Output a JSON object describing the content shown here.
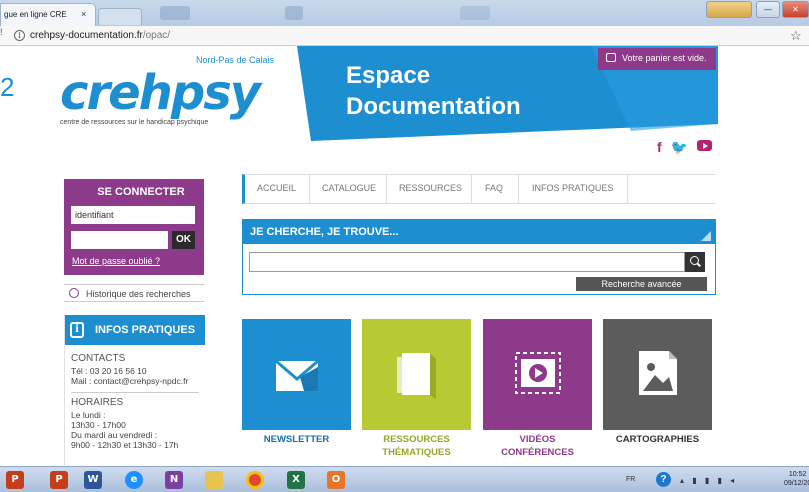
{
  "browser": {
    "tab_title": "gue en ligne CRE",
    "tab_close": "×",
    "address_domain": "crehpsy-documentation.fr",
    "address_path": "/opac/",
    "left_crumb": "!",
    "win_controls": [
      "",
      "—",
      "✕"
    ]
  },
  "site": {
    "stray_char": "2",
    "logo": {
      "region": "Nord-Pas de Calais",
      "word": "crehpsy",
      "tagline": "centre de ressources sur le handicap psychique"
    },
    "banner_line1": "Espace",
    "banner_line2": "Documentation",
    "cart_text": "Votre panier est vide.",
    "socials": [
      "f",
      "t",
      "youtube"
    ],
    "colors": {
      "blue": "#1d8fd1",
      "purple": "#8e3a8b",
      "green": "#b7c933",
      "magenta": "#b5236f",
      "gray": "#5c5c5c"
    }
  },
  "login": {
    "title": "SE CONNECTER",
    "id_placeholder": "identifiant",
    "ok": "OK",
    "forgot": "Mot de passe oublié ?"
  },
  "history": {
    "label": "Historique des recherches",
    "icon": "history-icon"
  },
  "infos": {
    "title": "INFOS PRATIQUES",
    "contacts_head": "CONTACTS",
    "tel": "Tél : 03 20 16 56 10",
    "mail": "Mail : contact@crehpsy-npdc.fr",
    "hours_head": "HORAIRES",
    "h1": "Le lundi :",
    "h2": "13h30 - 17h00",
    "h3": "Du mardi au vendredi :",
    "h4": "9h00 - 12h30 et 13h30 - 17h"
  },
  "nav": [
    "ACCUEIL",
    "CATALOGUE",
    "RESSOURCES",
    "FAQ",
    "INFOS PRATIQUES"
  ],
  "search": {
    "title": "JE CHERCHE, JE TROUVE...",
    "placeholder": "",
    "advanced": "Recherche avancée"
  },
  "tiles": [
    {
      "label1": "NEWSLETTER",
      "label2": "",
      "color": "#1d8fd1",
      "text_color": "#1a6ea8",
      "icon": "envelope-icon"
    },
    {
      "label1": "RESSOURCES",
      "label2": "THÉMATIQUES",
      "color": "#b7c933",
      "text_color": "#98a52a",
      "icon": "book-icon"
    },
    {
      "label1": "VIDÉOS",
      "label2": "CONFÉRENCES",
      "color": "#8e3a8b",
      "text_color": "#8e3a8b",
      "icon": "video-icon"
    },
    {
      "label1": "CARTOGRAPHIES",
      "label2": "",
      "color": "#5c5c5c",
      "text_color": "#333333",
      "icon": "image-icon"
    }
  ],
  "taskbar": {
    "lang": "FR",
    "help": "?",
    "time": "10:52",
    "date": "09/12/20",
    "apps": [
      "P",
      "W",
      "e",
      "N",
      "",
      "",
      "X",
      "O"
    ]
  }
}
